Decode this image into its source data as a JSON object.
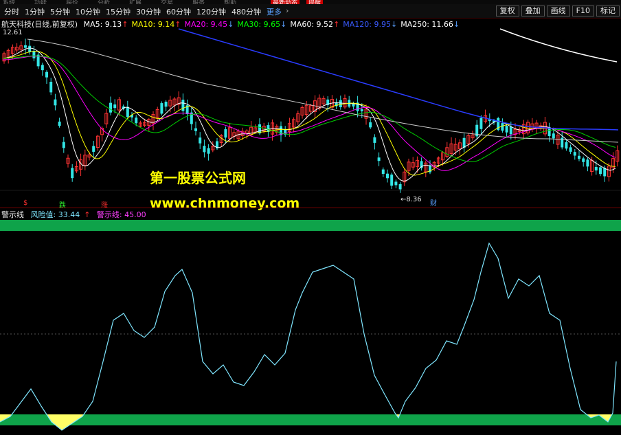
{
  "top_strip": {
    "items": [
      "系统",
      "功能",
      "报价",
      "分析",
      "扩展",
      "交易",
      "服务",
      "帮助"
    ],
    "highlight_1": "最新动态",
    "highlight_2": "提醒"
  },
  "toolbar": {
    "periods": [
      "分时",
      "1分钟",
      "5分钟",
      "10分钟",
      "15分钟",
      "30分钟",
      "60分钟",
      "120分钟",
      "480分钟"
    ],
    "more_label": "更多",
    "more_chevron": "›",
    "right_buttons": [
      "复权",
      "叠加",
      "画线",
      "F10",
      "标记"
    ]
  },
  "main_chart": {
    "title": "航天科技(日线,前复权)",
    "mas": [
      {
        "label": "MA5: 9.13",
        "arrow": "↑",
        "color": "#ffffff"
      },
      {
        "label": "MA10: 9.14",
        "arrow": "↑",
        "color": "#ffff00"
      },
      {
        "label": "MA20: 9.45",
        "arrow": "↓",
        "color": "#ff00ff"
      },
      {
        "label": "MA30: 9.65",
        "arrow": "↓",
        "color": "#00ff00"
      },
      {
        "label": "MA60: 9.52",
        "arrow": "↑",
        "color": "#ffffff"
      },
      {
        "label": "MA120: 9.95",
        "arrow": "↓",
        "color": "#3a5bff"
      },
      {
        "label": "MA250: 11.66",
        "arrow": "↓",
        "color": "#ffffff"
      }
    ],
    "high_label": "12.61",
    "low_label": "8.36",
    "low_marker": "←",
    "cai_label": "财",
    "signals": [
      {
        "text": "$",
        "color": "#ff3030"
      },
      {
        "text": "跌",
        "color": "#30ff30"
      },
      {
        "text": "涨",
        "color": "#ff3030"
      }
    ]
  },
  "watermark": {
    "line1": "第一股票公式网",
    "line2": "www.chnmoney.com"
  },
  "lower_chart": {
    "name": "警示线",
    "risk_label": "风险值: 33.44",
    "risk_arrow": "↑",
    "warn_label": "警示线: 45.00",
    "line_color": "#7fe6ff",
    "band_color": "#0fa34a",
    "fill_color": "#ffff66"
  },
  "colors": {
    "up": "#ff3333",
    "down": "#33e6e6",
    "bg": "#000000"
  }
}
